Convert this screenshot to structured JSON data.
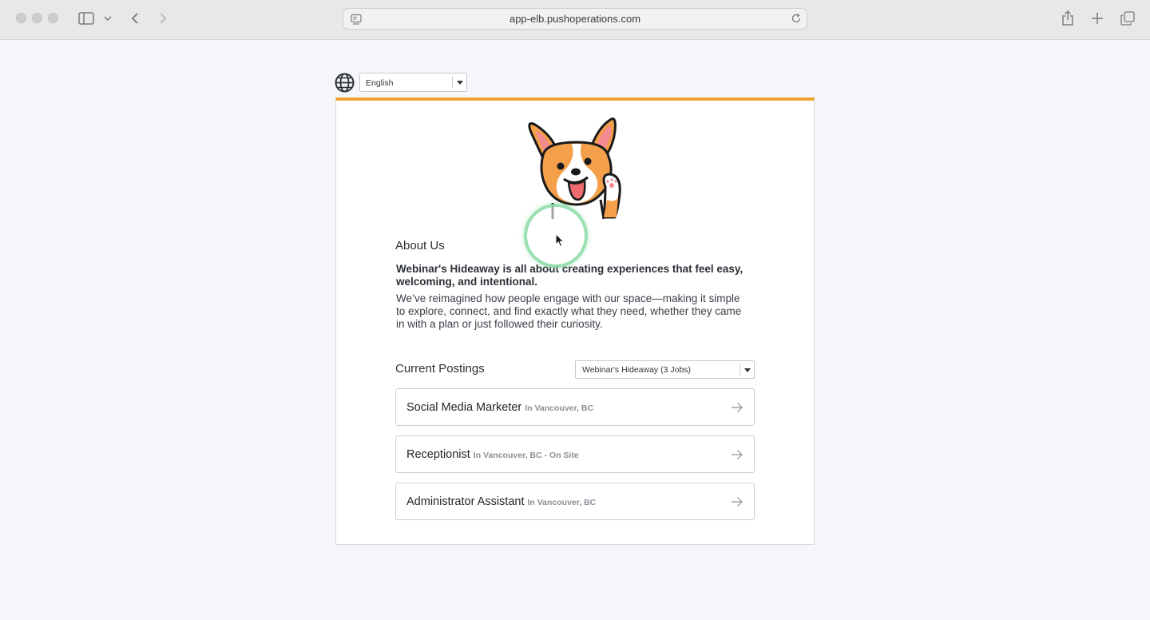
{
  "browser": {
    "url": "app-elb.pushoperations.com",
    "icons": [
      "sidebar-icon",
      "chevron-down-icon",
      "back-icon",
      "forward-icon",
      "site-settings-icon",
      "reload-icon",
      "share-icon",
      "new-tab-icon",
      "tabs-overview-icon"
    ]
  },
  "language": {
    "selected": "English",
    "icon": "globe-icon"
  },
  "accent_color": "#f0a22e",
  "about": {
    "title": "About Us",
    "lead": "Webinar's Hideaway is all about creating experiences that feel easy, welcoming, and intentional.",
    "body": "We’ve reimagined how people engage with our space—making it simple to explore, connect, and find exactly what they need, whether they came in with a plan or just followed their curiosity."
  },
  "postings": {
    "title": "Current Postings",
    "filter": "Webinar's Hideaway (3 Jobs)",
    "jobs": [
      {
        "title": "Social Media Marketer",
        "location": "In Vancouver, BC"
      },
      {
        "title": "Receptionist",
        "location": "In Vancouver, BC - On Site"
      },
      {
        "title": "Administrator Assistant",
        "location": "In Vancouver, BC"
      }
    ]
  }
}
